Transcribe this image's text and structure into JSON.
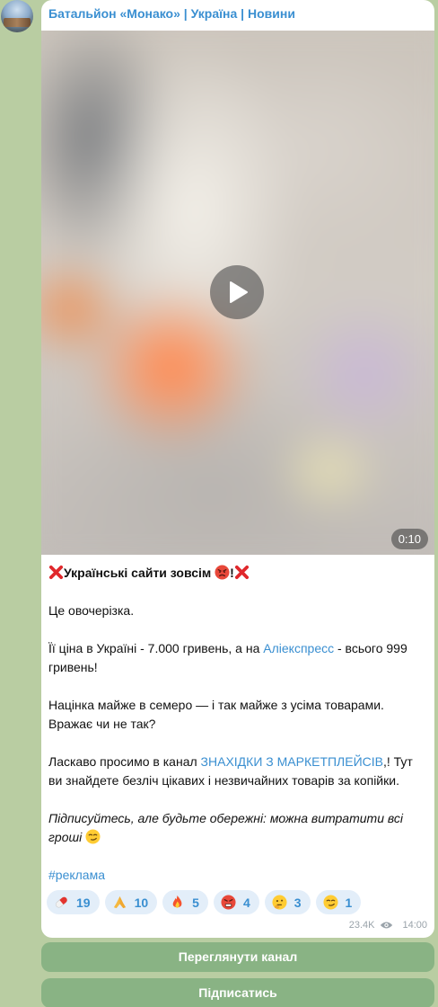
{
  "channel": {
    "name": "Батальйон «Монако» | Україна | Новини"
  },
  "video": {
    "duration": "0:10"
  },
  "post": {
    "title_text": "Українські сайти зовсім ",
    "title_mark": "!",
    "p1": "Це овочерізка.",
    "p2_a": "Її ціна в Україні - 7.000 гривень, а на ",
    "p2_link": "Аліекспресс",
    "p2_b": " - всього 999 гривень!",
    "p3": "Націнка майже в семеро — і так майже з усіма товарами. Вражає чи не так?",
    "p4_a": "Ласкаво просимо в канал ",
    "p4_link": "ЗНАХІДКИ З МАРКЕТПЛЕЙСІВ",
    "p4_b": ",! Тут ви знайдете безліч цікавих і незвичайних товарів за копійки.",
    "p5": "Підписуйтесь, але будьте обережні: можна витратити всі гроші ",
    "hashtag": "#реклама"
  },
  "reactions": [
    {
      "icon": "pill-emoji",
      "count": "19"
    },
    {
      "icon": "folded-hands-emoji",
      "count": "10"
    },
    {
      "icon": "fire-emoji",
      "count": "5"
    },
    {
      "icon": "angry-face-emoji",
      "count": "4"
    },
    {
      "icon": "thinking-face-emoji",
      "count": "3"
    },
    {
      "icon": "smirking-face-emoji",
      "count": "1"
    }
  ],
  "meta": {
    "views": "23.4K",
    "time": "14:00"
  },
  "buttons": {
    "view_channel": "Переглянути канал",
    "subscribe": "Підписатись"
  },
  "colors": {
    "background": "#b9cda2",
    "accent": "#3a8fd1",
    "button": "#89b384"
  }
}
